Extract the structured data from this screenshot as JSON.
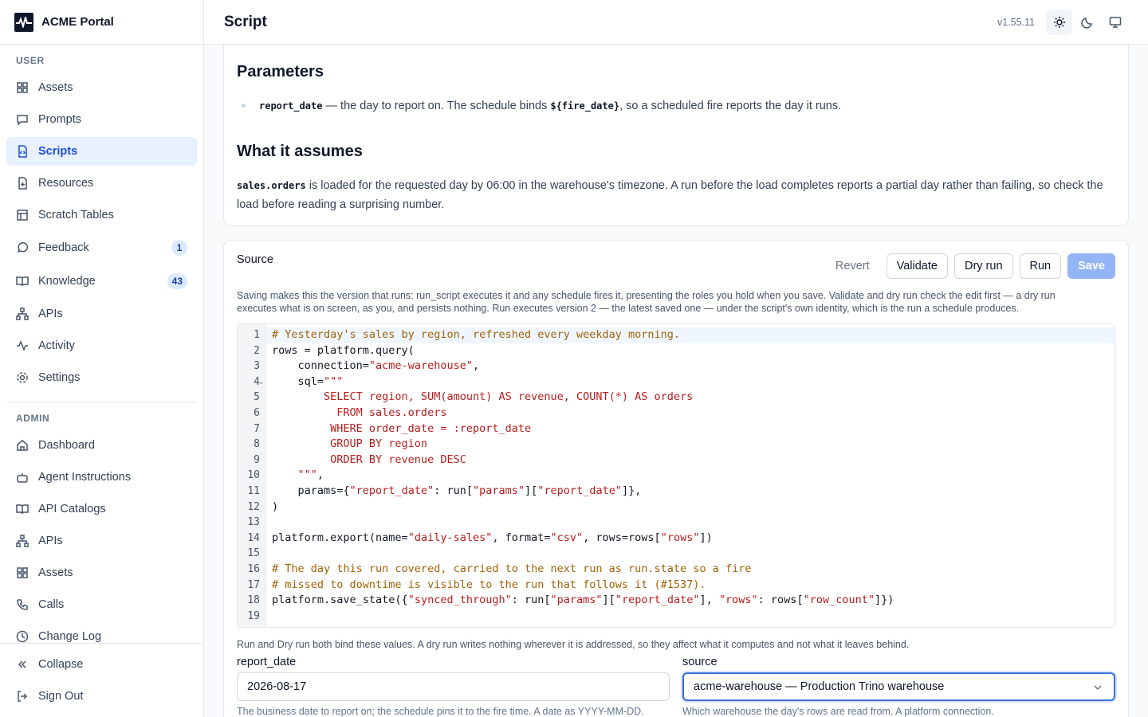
{
  "app": {
    "name": "ACME Portal",
    "version": "v1.55.11"
  },
  "header": {
    "title": "Script"
  },
  "sidebar": {
    "user_label": "USER",
    "user_items": [
      {
        "label": "Assets",
        "icon": "grid-icon"
      },
      {
        "label": "Prompts",
        "icon": "message-square-icon"
      },
      {
        "label": "Scripts",
        "icon": "file-code-icon",
        "active": true
      },
      {
        "label": "Resources",
        "icon": "file-plus-icon"
      },
      {
        "label": "Scratch Tables",
        "icon": "table-icon"
      },
      {
        "label": "Feedback",
        "icon": "message-circle-icon",
        "badge": "1"
      },
      {
        "label": "Knowledge",
        "icon": "book-open-icon",
        "badge": "43"
      },
      {
        "label": "APIs",
        "icon": "network-icon"
      },
      {
        "label": "Activity",
        "icon": "activity-icon"
      },
      {
        "label": "Settings",
        "icon": "gear-icon"
      }
    ],
    "admin_label": "ADMIN",
    "admin_items": [
      {
        "label": "Dashboard",
        "icon": "home-icon"
      },
      {
        "label": "Agent Instructions",
        "icon": "bot-icon"
      },
      {
        "label": "API Catalogs",
        "icon": "book-open-icon"
      },
      {
        "label": "APIs",
        "icon": "network-icon"
      },
      {
        "label": "Assets",
        "icon": "grid-icon"
      },
      {
        "label": "Calls",
        "icon": "phone-icon"
      },
      {
        "label": "Change Log",
        "icon": "clock-icon"
      }
    ],
    "collapse": "Collapse",
    "signout": "Sign Out"
  },
  "doc": {
    "parameters_heading": "Parameters",
    "param_name": "report_date",
    "param_text_1": " — the day to report on. The schedule binds ",
    "param_code_2": "${fire_date}",
    "param_text_2": ", so a scheduled fire reports the day it runs.",
    "assumes_heading": "What it assumes",
    "assumes_code": "sales.orders",
    "assumes_text": " is loaded for the requested day by 06:00 in the warehouse's timezone. A run before the load completes reports a partial day rather than failing, so check the load before reading a surprising number."
  },
  "source": {
    "label": "Source",
    "revert": "Revert",
    "validate": "Validate",
    "dry_run": "Dry run",
    "run": "Run",
    "save": "Save",
    "help_1": "Saving makes this the version that runs: run_script executes it and any schedule fires it, presenting the roles you hold when you save. Validate and dry run check the edit first — a dry run",
    "help_2": "executes what is on screen, as you, and persists nothing. Run executes version 2 — the latest saved one — under the script's own identity, which is the run a schedule produces."
  },
  "code_lines": [
    "# Yesterday's sales by region, refreshed every weekday morning.",
    "rows = platform.query(",
    "    connection=\"acme-warehouse\",",
    "    sql=\"\"\"",
    "        SELECT region, SUM(amount) AS revenue, COUNT(*) AS orders",
    "          FROM sales.orders",
    "         WHERE order_date = :report_date",
    "         GROUP BY region",
    "         ORDER BY revenue DESC",
    "    \"\"\",",
    "    params={\"report_date\": run[\"params\"][\"report_date\"]},",
    ")",
    "",
    "platform.export(name=\"daily-sales\", format=\"csv\", rows=rows[\"rows\"])",
    "",
    "# The day this run covered, carried to the next run as run.state so a fire",
    "# missed to downtime is visible to the run that follows it (#1537).",
    "platform.save_state({\"synced_through\": run[\"params\"][\"report_date\"], \"rows\": rows[\"row_count\"]})",
    ""
  ],
  "params_form": {
    "bind_help": "Run and Dry run both bind these values. A dry run writes nothing wherever it is addressed, so they affect what it computes and not what it leaves behind.",
    "report_date_label": "report_date",
    "report_date_value": "2026-08-17",
    "report_date_help": "The business date to report on; the schedule pins it to the fire time. A date as YYYY-MM-DD.",
    "source_label": "source",
    "source_value": "acme-warehouse — Production Trino warehouse",
    "source_help": "Which warehouse the day's rows are read from. A platform connection."
  },
  "colors": {
    "accent": "#1d4ed8",
    "active_bg": "#e8f0fe",
    "save_disabled": "#93b5f5",
    "code_string": "#b91c1c",
    "code_comment": "#a16207"
  }
}
